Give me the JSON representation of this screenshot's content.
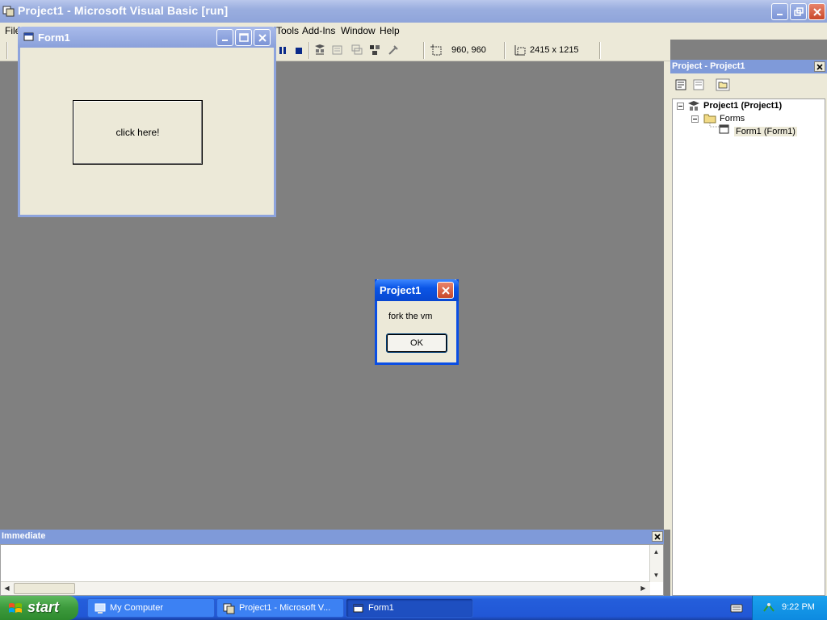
{
  "main_window": {
    "title": "Project1 - Microsoft Visual Basic [run]",
    "menu": [
      "File",
      "Tools",
      "Add-Ins",
      "Window",
      "Help"
    ]
  },
  "toolbar": {
    "position": "960, 960",
    "size": "2415 x 1215"
  },
  "form1": {
    "title": "Form1",
    "button_label": "click here!"
  },
  "msgbox": {
    "title": "Project1",
    "message": "fork the vm",
    "ok_label": "OK"
  },
  "project_explorer": {
    "title": "Project - Project1",
    "tree": {
      "root": "Project1 (Project1)",
      "folder": "Forms",
      "item": "Form1 (Form1)"
    }
  },
  "immediate": {
    "title": "Immediate"
  },
  "taskbar": {
    "start_label": "start",
    "tasks": [
      {
        "label": "My Computer"
      },
      {
        "label": "Project1 - Microsoft V..."
      },
      {
        "label": "Form1"
      }
    ],
    "clock": "9:22 PM"
  },
  "colors": {
    "xp_blue": "#0a55e6",
    "inactive_title": "#8fa4da",
    "face": "#ece9d8",
    "start_green": "#3c9a3c"
  }
}
